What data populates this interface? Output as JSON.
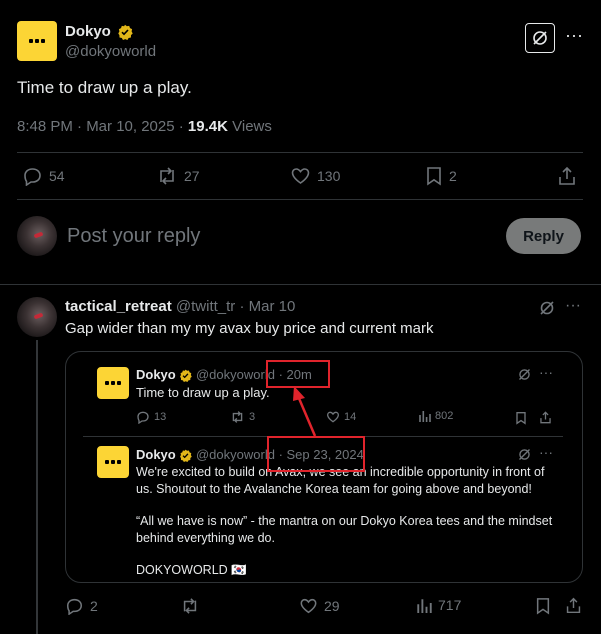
{
  "main_post": {
    "name": "Dokyo",
    "handle": "@dokyoworld",
    "text": "Time to draw up a play.",
    "time": "8:48 PM · Mar 10, 2025 ·",
    "views_count": "19.4K",
    "views_label": "Views",
    "stats": {
      "replies": "54",
      "reposts": "27",
      "likes": "130",
      "bookmarks": "2"
    }
  },
  "reply_composer": {
    "placeholder": "Post your reply",
    "button": "Reply"
  },
  "reply": {
    "name": "tactical_retreat",
    "handle": "@twitt_tr",
    "time": "· Mar 10",
    "text": "Gap wider than my my avax buy price and current mark",
    "stats": {
      "replies": "2",
      "likes": "29",
      "views": "717"
    }
  },
  "quote_1": {
    "name": "Dokyo",
    "handle": "@dokyoworld",
    "time": "· 20m",
    "text": "Time to draw up a play.",
    "stats": {
      "replies": "13",
      "reposts": "3",
      "likes": "14",
      "views": "802"
    }
  },
  "quote_2": {
    "name": "Dokyo",
    "handle": "@dokyoworld",
    "time": "· Sep 23, 2024",
    "line1": "We're excited to build on Avax, we see an incredible opportunity in front of",
    "line2": "us. Shoutout to the Avalanche Korea team for going above and beyond!",
    "line3": "“All we have is now” - the mantra on our Dokyo Korea tees and the mindset",
    "line4": "behind everything we do.",
    "line5": "DOKYOWORLD",
    "flag": "🇰🇷"
  },
  "colors": {
    "accent_red": "#e0242c",
    "verified_gold": "#e2b719",
    "brand_yellow": "#fcd535"
  }
}
